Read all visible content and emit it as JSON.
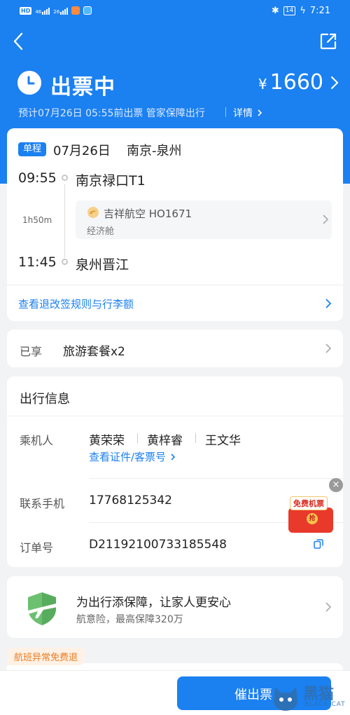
{
  "status_bar": {
    "left_badge": "HD",
    "signal_1": "46",
    "signal_2": "26",
    "battery": "14",
    "time": "7:21"
  },
  "order": {
    "status": "出票中",
    "currency": "¥",
    "price": "1660",
    "subline": "预计07月26日 05:55前出票 管家保障出行",
    "detail_link": "详情"
  },
  "flight": {
    "badge": "单程",
    "date": "07月26日",
    "route": "南京-泉州",
    "depart_time": "09:55",
    "depart_airport": "南京禄口T1",
    "duration": "1h50m",
    "airline": "吉祥航空 HO1671",
    "cabin": "经济舱",
    "arrive_time": "11:45",
    "arrive_airport": "泉州晋江",
    "rules_link": "查看退改签规则与行李额"
  },
  "enjoyed": {
    "label": "已享",
    "value": "旅游套餐x2"
  },
  "travel_info": {
    "title": "出行信息",
    "passengers_label": "乘机人",
    "passengers": [
      "黄荣荣",
      "黄梓睿",
      "王文华"
    ],
    "id_link": "查看证件/客票号",
    "phone_label": "联系手机",
    "phone": "17768125342",
    "order_label": "订单号",
    "order_no": "D2119210073318554​8"
  },
  "ad": {
    "close": "×",
    "tag": "免费机票",
    "coin": "抢"
  },
  "insurance": {
    "title": "为出行添保障，让家人更安心",
    "subtitle": "航意险，最高保障320万"
  },
  "bottom": {
    "tag": "航班异常免费退",
    "urge_button": "催出票",
    "watermark": "黑猫",
    "watermark_sub": "BLACK CAT"
  },
  "colors": {
    "primary": "#1b80f0",
    "background": "#f2f3f5",
    "tag_orange": "#e87d22"
  }
}
